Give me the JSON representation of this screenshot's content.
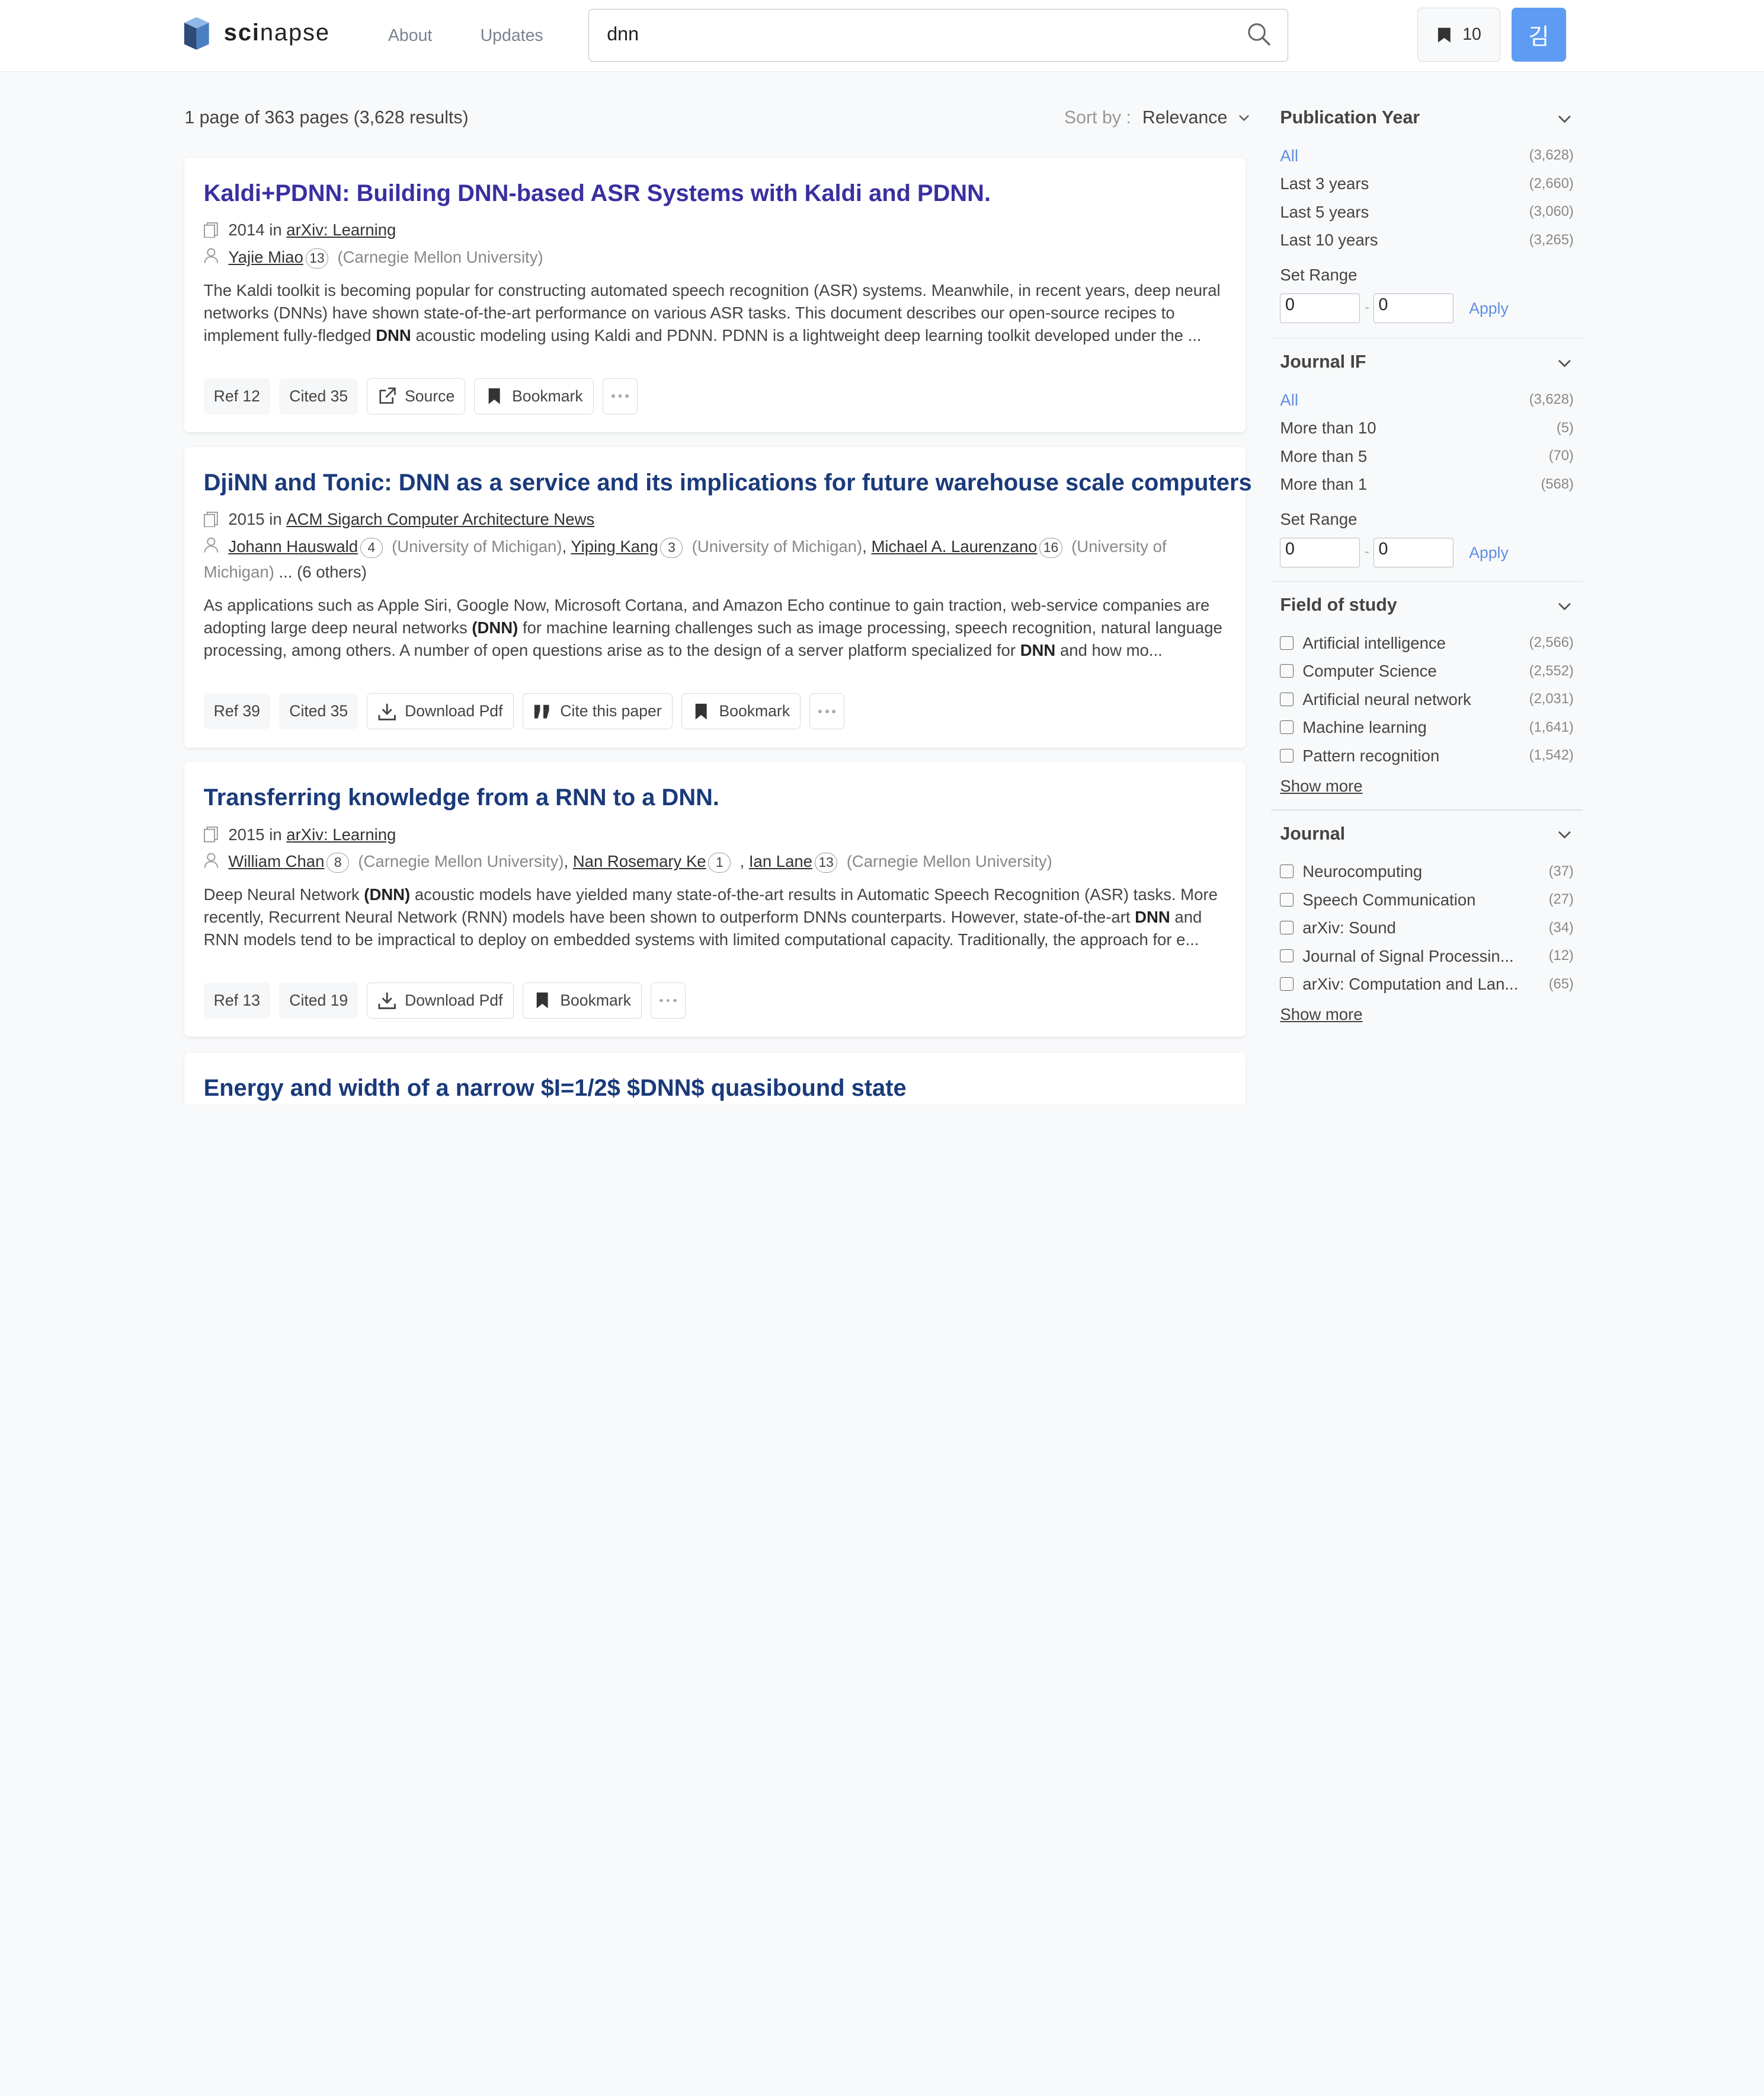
{
  "header": {
    "logo_text": "scinapse",
    "nav": [
      "About",
      "Updates"
    ],
    "search_value": "dnn",
    "bookmark_count": "10",
    "avatar_initial": "김"
  },
  "results": {
    "count_text": "1 page of 363 pages (3,628 results)",
    "sort_label": "Sort by :",
    "sort_value": "Relevance"
  },
  "papers": [
    {
      "title": "Kaldi+PDNN: Building DNN-based ASR Systems with Kaldi and PDNN.",
      "year_in": "2014 in",
      "venue": "arXiv: Learning",
      "authors": [
        {
          "name": "Yajie Miao",
          "h": "13",
          "aff": "(Carnegie Mellon University)"
        }
      ],
      "abstract_parts": [
        "The Kaldi toolkit is becoming popular for constructing automated speech recognition (ASR) systems. Meanwhile, in recent years, deep neural networks (DNNs) have shown state-of-the-art performance on various ASR tasks. This document describes our open-source recipes to implement fully-fledged ",
        "DNN",
        " acoustic modeling using Kaldi and PDNN. PDNN is a lightweight deep learning toolkit developed under the ..."
      ],
      "ref": "Ref 12",
      "cited": "Cited 35",
      "btn_source": "Source",
      "btn_bookmark": "Bookmark"
    },
    {
      "title": "DjiNN and Tonic: DNN as a service and its implications for future warehouse scale computers",
      "year_in": "2015 in",
      "venue": "ACM Sigarch Computer Architecture News",
      "authors": [
        {
          "name": "Johann Hauswald",
          "h": "4",
          "aff": "(University of Michigan)"
        },
        {
          "name": "Yiping Kang",
          "h": "3",
          "aff": "(University of Michigan)"
        },
        {
          "name": "Michael A. Laurenzano",
          "h": "16",
          "aff": "(University of Michigan)"
        }
      ],
      "others": "... (6 others)",
      "abstract_parts": [
        "As applications such as Apple Siri, Google Now, Microsoft Cortana, and Amazon Echo continue to gain traction, web-service companies are adopting large deep neural networks ",
        "(DNN)",
        " for machine learning challenges such as image processing, speech recognition, natural language processing, among others. A number of open questions arise as to the design of a server platform specialized for ",
        "DNN",
        " and how mo..."
      ],
      "ref": "Ref 39",
      "cited": "Cited 35",
      "btn_pdf": "Download Pdf",
      "btn_cite": "Cite this paper",
      "btn_bookmark": "Bookmark"
    },
    {
      "title": "Transferring knowledge from a RNN to a DNN.",
      "year_in": "2015 in",
      "venue": "arXiv: Learning",
      "authors": [
        {
          "name": "William Chan",
          "h": "8",
          "aff": "(Carnegie Mellon University)"
        },
        {
          "name": "Nan Rosemary Ke",
          "h": "1"
        },
        {
          "name": "Ian Lane",
          "h": "13",
          "aff": "(Carnegie Mellon University)"
        }
      ],
      "abstract_parts": [
        "Deep Neural Network ",
        "(DNN)",
        " acoustic models have yielded many state-of-the-art results in Automatic Speech Recognition (ASR) tasks. More recently, Recurrent Neural Network (RNN) models have been shown to outperform DNNs counterparts. However, state-of-the-art ",
        "DNN",
        " and RNN models tend to be impractical to deploy on embedded systems with limited computational capacity. Traditionally, the approach for e..."
      ],
      "ref": "Ref 13",
      "cited": "Cited 19",
      "btn_pdf": "Download Pdf",
      "btn_bookmark": "Bookmark"
    },
    {
      "title": "Energy and width of a narrow $I=1/2$ $DNN$ quasibound state"
    }
  ],
  "filters": {
    "pub_year": {
      "title": "Publication Year",
      "rows": [
        {
          "label": "All",
          "count": "(3,628)"
        },
        {
          "label": "Last 3 years",
          "count": "(2,660)"
        },
        {
          "label": "Last 5 years",
          "count": "(3,060)"
        },
        {
          "label": "Last 10 years",
          "count": "(3,265)"
        }
      ],
      "set_range": "Set Range",
      "from": "0",
      "to": "0",
      "apply": "Apply"
    },
    "journal_if": {
      "title": "Journal IF",
      "rows": [
        {
          "label": "All",
          "count": "(3,628)"
        },
        {
          "label": "More than 10",
          "count": "(5)"
        },
        {
          "label": "More than 5",
          "count": "(70)"
        },
        {
          "label": "More than 1",
          "count": "(568)"
        }
      ],
      "set_range": "Set Range",
      "from": "0",
      "to": "0",
      "apply": "Apply"
    },
    "field": {
      "title": "Field of study",
      "rows": [
        {
          "label": "Artificial intelligence",
          "count": "(2,566)"
        },
        {
          "label": "Computer Science",
          "count": "(2,552)"
        },
        {
          "label": "Artificial neural network",
          "count": "(2,031)"
        },
        {
          "label": "Machine learning",
          "count": "(1,641)"
        },
        {
          "label": "Pattern recognition",
          "count": "(1,542)"
        }
      ],
      "show_more": "Show more"
    },
    "journal": {
      "title": "Journal",
      "rows": [
        {
          "label": "Neurocomputing",
          "count": "(37)"
        },
        {
          "label": "Speech Communication",
          "count": "(27)"
        },
        {
          "label": "arXiv: Sound",
          "count": "(34)"
        },
        {
          "label": "Journal of Signal Processin...",
          "count": "(12)"
        },
        {
          "label": "arXiv: Computation and Lan...",
          "count": "(65)"
        }
      ],
      "show_more": "Show more"
    }
  }
}
